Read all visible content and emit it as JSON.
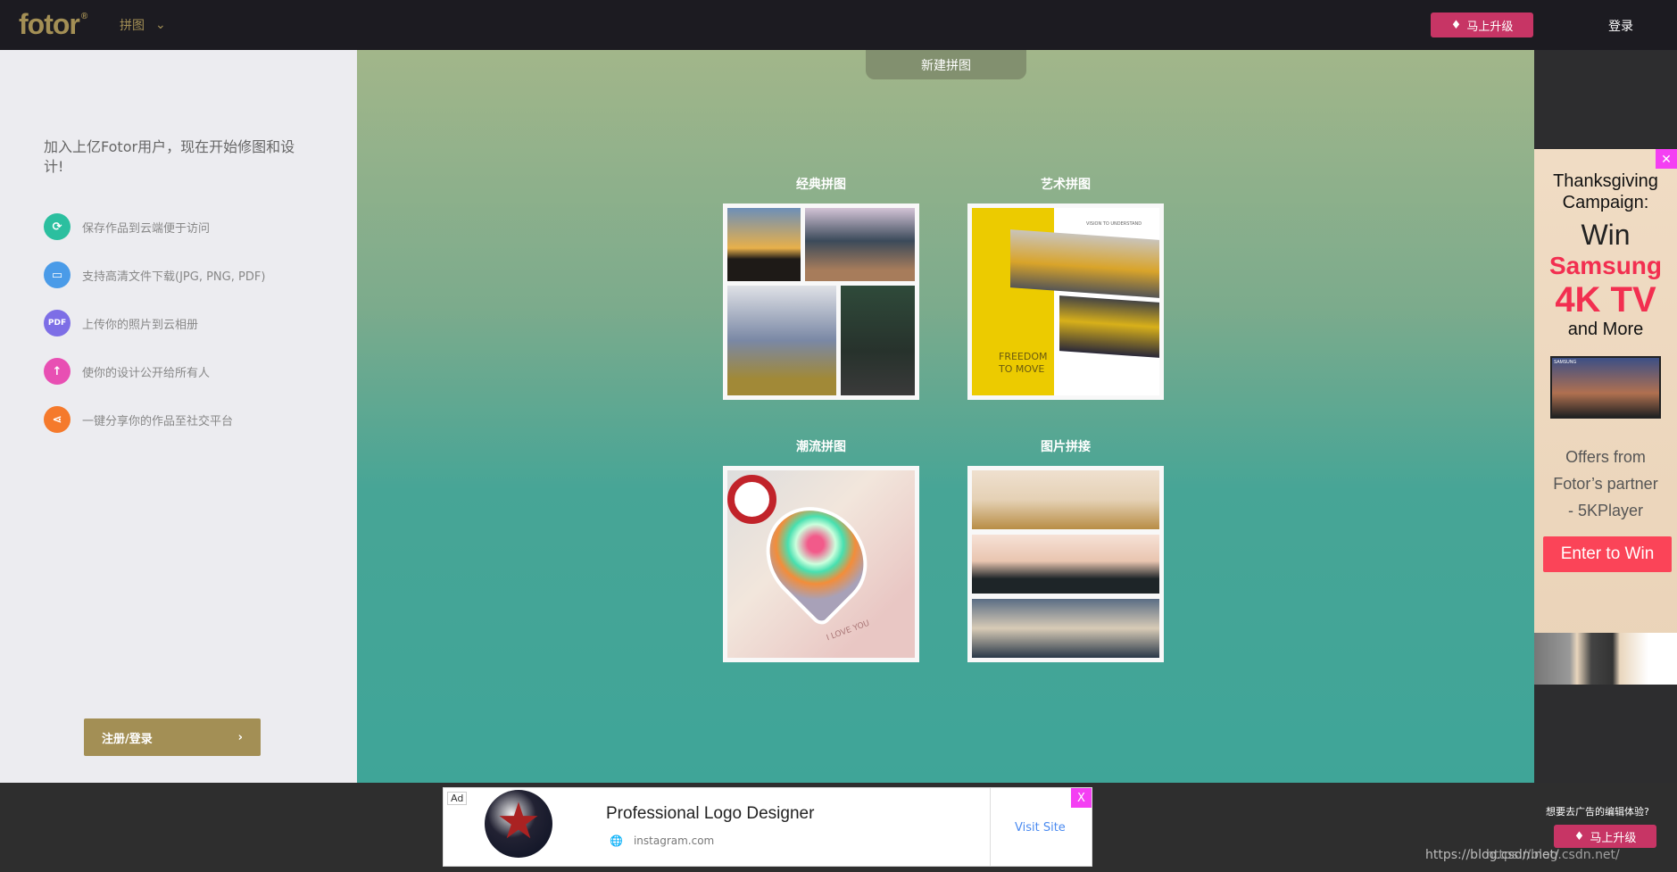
{
  "header": {
    "logo": "fotor",
    "logo_mark": "®",
    "menu_label": "拼图",
    "upgrade_label": "马上升级",
    "login_label": "登录"
  },
  "sidebar": {
    "intro": "加入上亿Fotor用户，现在开始修图和设计!",
    "features": [
      {
        "icon": "sync-icon",
        "glyph": "⟳",
        "color": "#2bbf9f",
        "label": "保存作品到云端便于访问"
      },
      {
        "icon": "laptop-icon",
        "glyph": "▭",
        "color": "#4a9be8",
        "label": "支持高清文件下载(JPG, PNG, PDF)"
      },
      {
        "icon": "pdf-icon",
        "glyph": "PDF",
        "color": "#7d6ee6",
        "label": "上传你的照片到云相册"
      },
      {
        "icon": "upload-arrow-icon",
        "glyph": "↑",
        "color": "#e84fb3",
        "label": "使你的设计公开给所有人"
      },
      {
        "icon": "share-icon",
        "glyph": "⋖",
        "color": "#f57a2c",
        "label": "一键分享你的作品至社交平台"
      }
    ],
    "register_label": "注册/登录"
  },
  "main": {
    "new_button": "新建拼图",
    "templates": [
      {
        "label": "经典拼图"
      },
      {
        "label": "艺术拼图",
        "caption": "VISION TO UNDERSTAND",
        "text1": "FREEDOM",
        "text2": "TO MOVE"
      },
      {
        "label": "潮流拼图",
        "stamp": "I LOVE YOU"
      },
      {
        "label": "图片拼接"
      }
    ]
  },
  "right_ad": {
    "line1": "Thanksgiving",
    "line2": "Campaign:",
    "win": "Win",
    "brand": "Samsung",
    "product": "4K TV",
    "more": "and More",
    "tv_brand": "SAMSUNG",
    "offer1": "Offers from",
    "offer2": "Fotor’s partner",
    "offer3": "- 5KPlayer",
    "cta": "Enter to Win",
    "close": "✕"
  },
  "bottom_ad": {
    "badge": "Ad",
    "title": "Professional Logo Designer",
    "domain": "instagram.com",
    "cta": "Visit Site",
    "close": "X"
  },
  "bottom": {
    "remove_ads_text": "想要去广告的编辑体验?",
    "upgrade_label": "马上升级",
    "watermark1": "https://blog.csdn.net/",
    "watermark2": "https://blog.csdn.net/"
  },
  "colors": {
    "gold": "#a38f55",
    "upgrade": "#c73565",
    "header_bg": "#1c1b21",
    "teal": "#3fa598",
    "ad_close": "#f43ff3"
  }
}
